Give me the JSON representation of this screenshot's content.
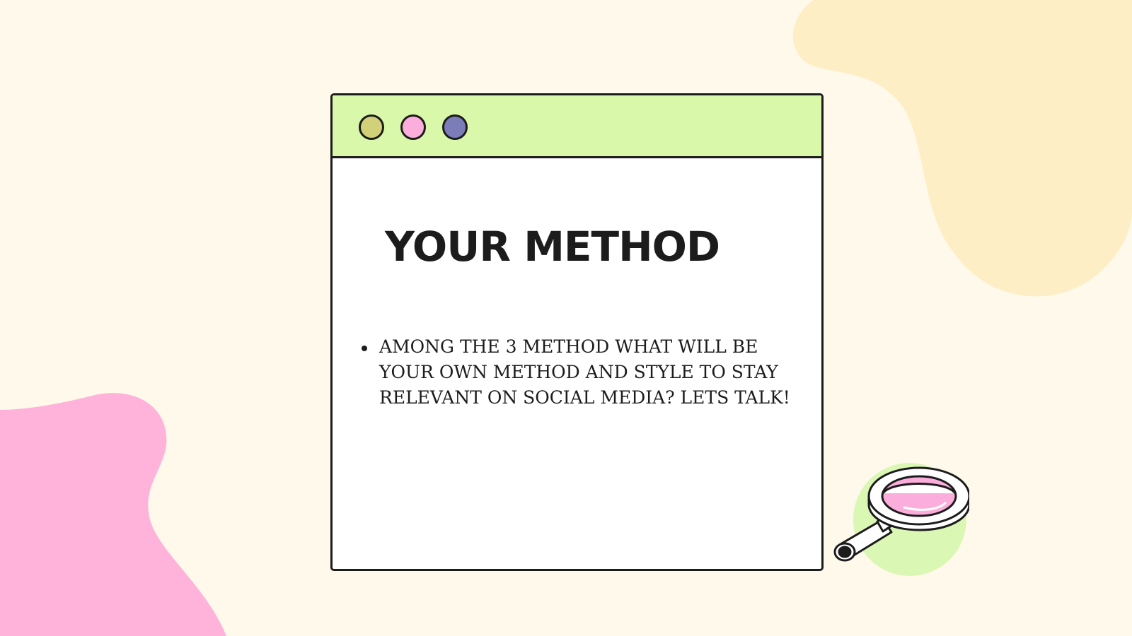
{
  "slide": {
    "title": "YOUR METHOD",
    "bullets": [
      "AMONG THE 3 METHOD WHAT WILL BE YOUR OWN METHOD AND STYLE TO STAY RELEVANT ON SOCIAL MEDIA? LETS TALK!"
    ]
  },
  "colors": {
    "background": "#fef9ea",
    "blob_top_right": "#feeec6",
    "blob_bottom_left": "#ffb3db",
    "titlebar": "#d9f8a9",
    "dot_1": "#d2d17a",
    "dot_2": "#fbaedc",
    "dot_3": "#7b7db8",
    "magnifier_backdrop": "#daf7b4",
    "magnifier_lens": "#fbaedc",
    "outline": "#1c1c1c"
  },
  "icons": {
    "window_dots": [
      "window-dot-icon",
      "window-dot-icon",
      "window-dot-icon"
    ],
    "decoration": "magnifying-glass-icon"
  }
}
